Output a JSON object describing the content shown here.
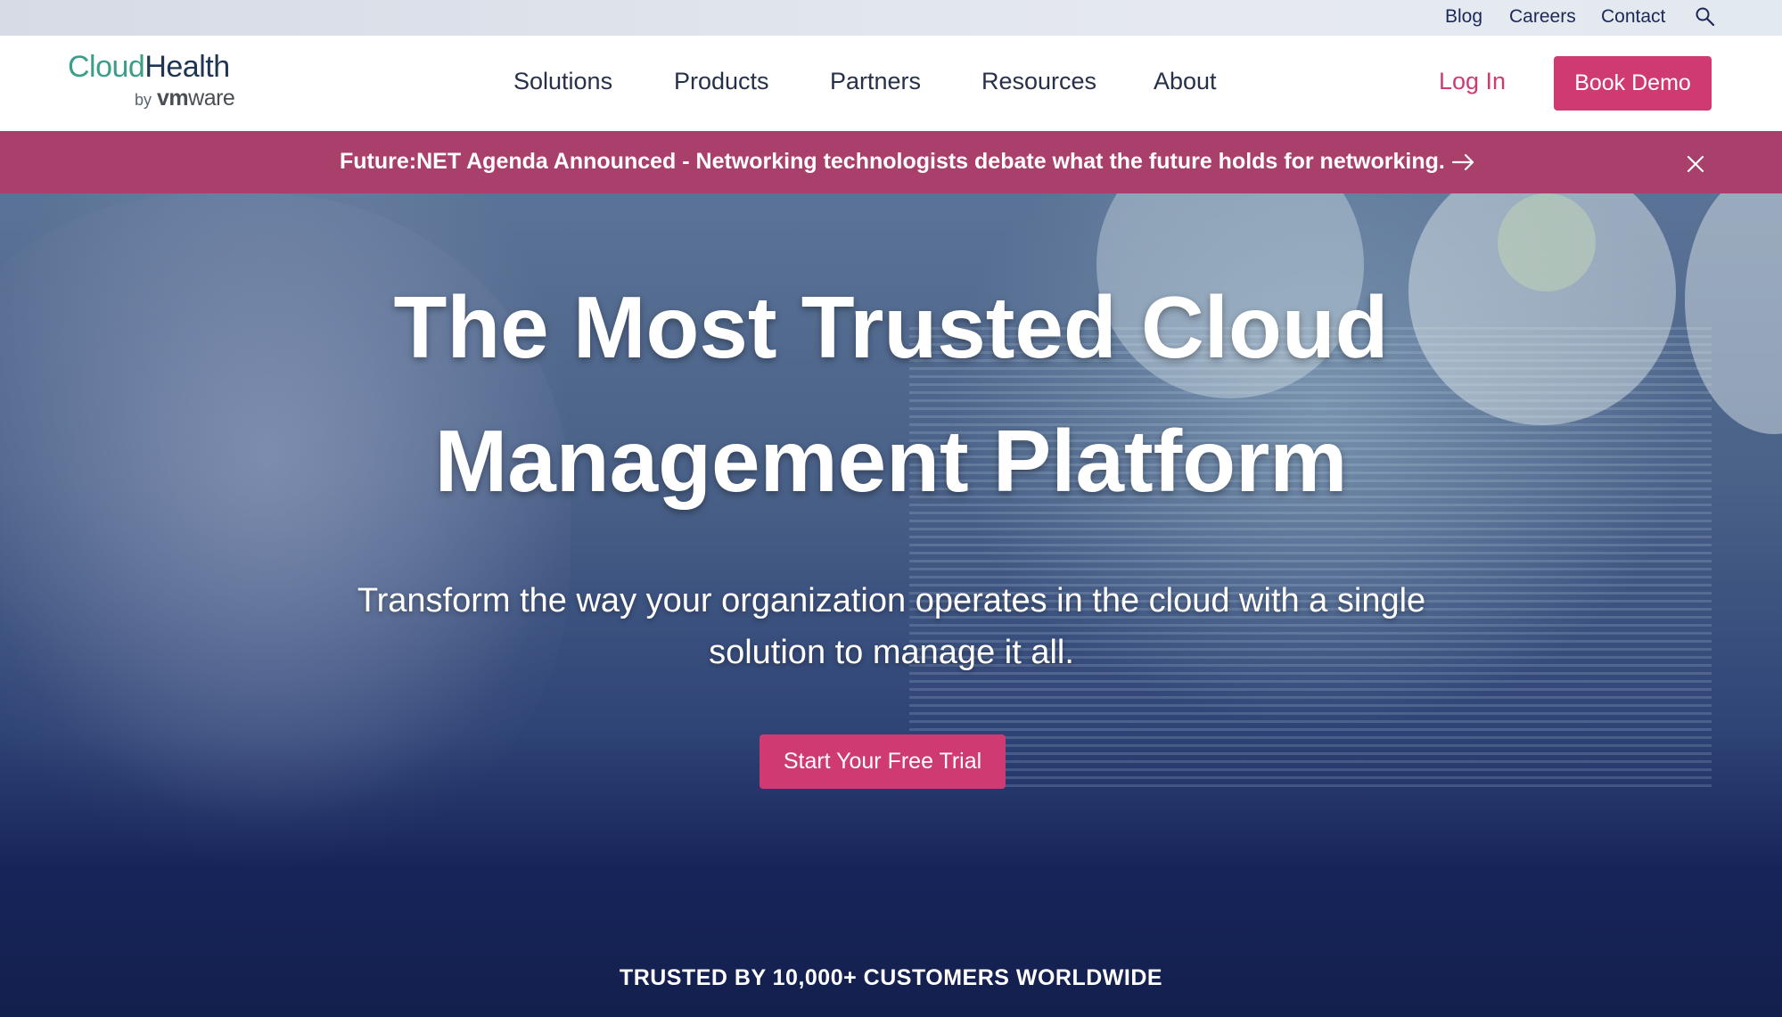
{
  "utility_nav": {
    "blog": "Blog",
    "careers": "Careers",
    "contact": "Contact",
    "search_icon": "search-icon"
  },
  "logo": {
    "brand_part1": "Cloud",
    "brand_part2": "Health",
    "by": "by",
    "vm": "vm",
    "ware": "ware"
  },
  "main_nav": {
    "items": [
      "Solutions",
      "Products",
      "Partners",
      "Resources",
      "About"
    ],
    "login": "Log In",
    "book_demo": "Book Demo"
  },
  "announcement": {
    "text": "Future:NET Agenda Announced - Networking technologists debate what the future holds for networking.",
    "arrow_icon": "arrow-right-icon",
    "close_icon": "close-icon"
  },
  "hero": {
    "title_line1": "The Most Trusted Cloud",
    "title_line2": "Management Platform",
    "subtitle_line1": "Transform the way your organization operates in the cloud with a single",
    "subtitle_line2": "solution to manage it all.",
    "cta": "Start Your Free Trial",
    "trusted": "TRUSTED BY 10,000+ CUSTOMERS WORLDWIDE"
  },
  "colors": {
    "brand_pink": "#cf3a72",
    "announcement_bg": "#a9406c",
    "navy": "#13204d",
    "logo_teal": "#3a9e8a"
  }
}
